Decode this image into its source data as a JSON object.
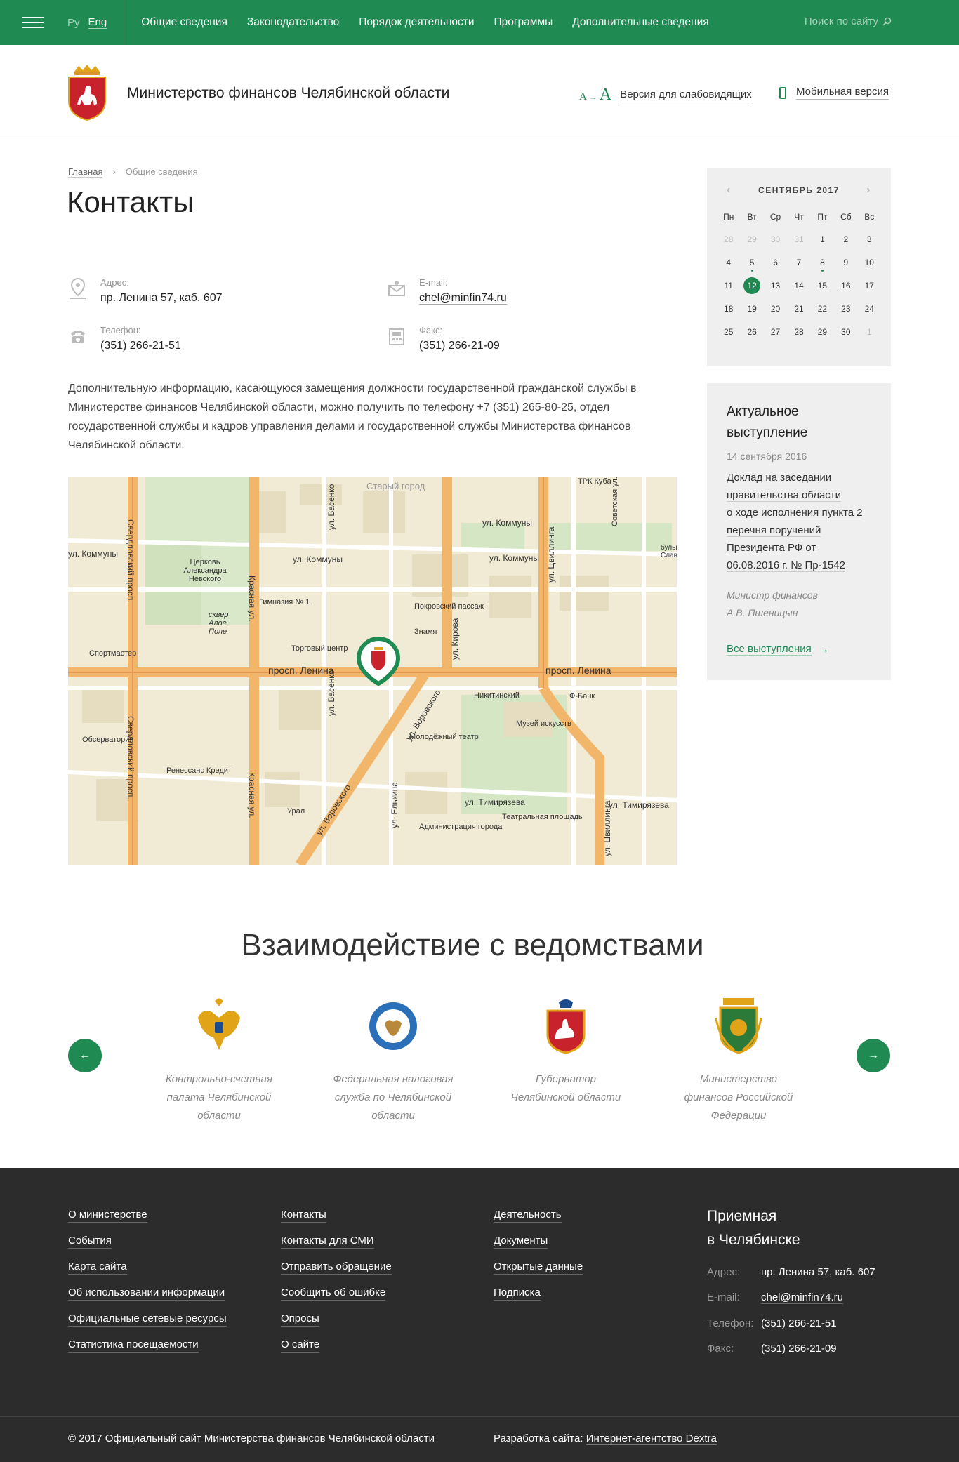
{
  "topbar": {
    "lang_ru": "Ру",
    "lang_en": "Eng",
    "nav": [
      "Общие сведения",
      "Законодательство",
      "Порядок деятельности",
      "Программы",
      "Дополнительные сведения"
    ],
    "search_placeholder": "Поиск по сайту",
    "color": "#1f8a52"
  },
  "header": {
    "ministry_name": "Министерство финансов Челябинской области",
    "a11y_small": "A",
    "a11y_large": "A",
    "a11y_label": "Версия для слабовидящих",
    "mobile_label": "Мобильная версия"
  },
  "breadcrumb": {
    "home": "Главная",
    "current": "Общие сведения"
  },
  "page": {
    "title": "Контакты"
  },
  "contacts": {
    "address_label": "Адрес:",
    "address": "пр. Ленина 57, каб. 607",
    "email_label": "E-mail:",
    "email": "chel@minfin74.ru",
    "phone_label": "Телефон:",
    "phone": "(351) 266-21-51",
    "fax_label": "Факс:",
    "fax": "(351) 266-21-09"
  },
  "info_text": "Дополнительную информацию, касающуюся замещения должности государственной гражданской службы в Министерстве финансов Челябинской области, можно получить по телефону +7 (351) 265-80-25, отдел государственной службы и кадров управления делами и государственной службы Министерства финансов Челябинской области.",
  "map": {
    "labels": {
      "old_town": "Старый город",
      "lenina1": "просп. Ленина",
      "lenina2": "просп. Ленина",
      "kommuny1": "ул. Коммуны",
      "kommuny2": "ул. Коммуны",
      "kommuny3": "ул. Коммуны",
      "kommuny4": "ул. Коммуны",
      "sverdl1": "Свердловский просп.",
      "sverdl2": "Свердловский просп.",
      "krasnaya1": "Красная ул.",
      "krasnaya2": "Красная ул.",
      "vorovskogo1": "ул. Воровского",
      "vorovskogo2": "ул. Воровского",
      "tsvillinga1": "ул. Цвиллинга",
      "tsvillinga2": "ул. Цвиллинга",
      "kirova": "ул. Кирова",
      "timiryazeva1": "ул. Тимирязева",
      "timiryazeva2": "ул. Тимирязева",
      "elkina": "ул. Елькина",
      "vasenko1": "ул. Васенко",
      "vasenko2": "ул. Васенко",
      "church": "Церковь Александра Невского",
      "square": "сквер Алое Поле",
      "gymnasium": "Гимназия № 1",
      "trade": "Торговый центр",
      "pokrov": "Покровский пассаж",
      "znamya": "Знамя",
      "nikitinsky": "Никитинский",
      "bank": "Ф-Банк",
      "museum": "Музей искусств",
      "youth_theatre": "Молодёжный театр",
      "renaissance": "Ренессанс Кредит",
      "observatory": "Обсерватория",
      "sportmaster": "Спортмастер",
      "ural": "Урал",
      "admin": "Администрация города",
      "theatre_sq": "Театральная площадь",
      "trk": "ТРК Куба",
      "sovetskaya": "Советская ул.",
      "blvd": "бульв. Славы"
    }
  },
  "calendar": {
    "month": "СЕНТЯБРЬ 2017",
    "dow": [
      "Пн",
      "Вт",
      "Ср",
      "Чт",
      "Пт",
      "Сб",
      "Вс"
    ],
    "weeks": [
      [
        "28",
        "29",
        "30",
        "31",
        "1",
        "2",
        "3"
      ],
      [
        "4",
        "5",
        "6",
        "7",
        "8",
        "9",
        "10"
      ],
      [
        "11",
        "12",
        "13",
        "14",
        "15",
        "16",
        "17"
      ],
      [
        "18",
        "19",
        "20",
        "21",
        "22",
        "23",
        "24"
      ],
      [
        "25",
        "26",
        "27",
        "28",
        "29",
        "30",
        "1"
      ]
    ],
    "today": "12",
    "event_days": [
      "5",
      "8"
    ]
  },
  "speech": {
    "title": "Актуальное выступление",
    "date": "14 сентября 2016",
    "lines": [
      "Доклад на заседании",
      "правительства области",
      "о ходе исполнения пункта 2",
      "перечня поручений",
      "Президента РФ от",
      "06.08.2016 г. № Пр-1542"
    ],
    "author_line1": "Министр финансов",
    "author_line2": "А.В. Пшеницын",
    "all_link": "Все выступления"
  },
  "partners": {
    "title": "Взаимодействие с ведомствами",
    "items": [
      {
        "name": "Контрольно-счетная палата Челябинской области",
        "icon": "eagle-emblem-icon"
      },
      {
        "name": "Федеральная налоговая служба по Челябинской области",
        "icon": "tax-service-emblem-icon"
      },
      {
        "name": "Губернатор Челябинской области",
        "icon": "chelyabinsk-crest-icon"
      },
      {
        "name": "Министерство финансов Российской Федерации",
        "icon": "minfin-rf-emblem-icon"
      }
    ]
  },
  "footer": {
    "col1": [
      "О министерстве",
      "События",
      "Карта сайта",
      "Об использовании информации",
      "Официальные сетевые ресурсы",
      "Статистика посещаемости"
    ],
    "col2": [
      "Контакты",
      "Контакты для СМИ",
      "Отправить обращение",
      "Сообщить об ошибке",
      "Опросы",
      "О сайте"
    ],
    "col3": [
      "Деятельность",
      "Документы",
      "Открытые данные",
      "Подписка"
    ],
    "reception_title1": "Приемная",
    "reception_title2": "в Челябинске",
    "address_label": "Адрес:",
    "address": "пр. Ленина 57, каб. 607",
    "email_label": "E-mail:",
    "email": "chel@minfin74.ru",
    "phone_label": "Телефон:",
    "phone": "(351) 266-21-51",
    "fax_label": "Факс:",
    "fax": "(351) 266-21-09",
    "copyright": "© 2017 Официальный сайт Министерства финансов Челябинской области",
    "dev_label": "Разработка сайта:",
    "dev_link": "Интернет-агентство Dextra"
  }
}
